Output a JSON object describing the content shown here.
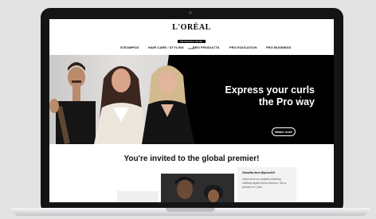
{
  "brand": {
    "name": "L'ORÉAL",
    "bar": "PROFESSIONNEL",
    "sub": "PARIS"
  },
  "nav": {
    "items": [
      {
        "label": "STEAMPOD"
      },
      {
        "label": "HAIR CARE / STYLING"
      },
      {
        "label": "PRO PRODUCTS"
      },
      {
        "label": "PRO EDUCATION"
      },
      {
        "label": "PRO BUSINESS"
      }
    ]
  },
  "hero": {
    "title_line1": "Express your curls",
    "title_line2": "the Pro way",
    "cta": "Watch now!",
    "arrow": "›",
    "slide_count": 2,
    "active_slide": 1
  },
  "invite": {
    "heading": "You're invited to the global premier!"
  },
  "card": {
    "tag": "#NowNorthernEpisode5",
    "body": "Learn from our experts including celebrity stylist Derick Monroe: Get a preview of Curls"
  },
  "colors": {
    "frame": "#141414",
    "hero_bg": "#000000",
    "accent_text": "#ffffff",
    "page_bg": "#e3e3e4"
  }
}
